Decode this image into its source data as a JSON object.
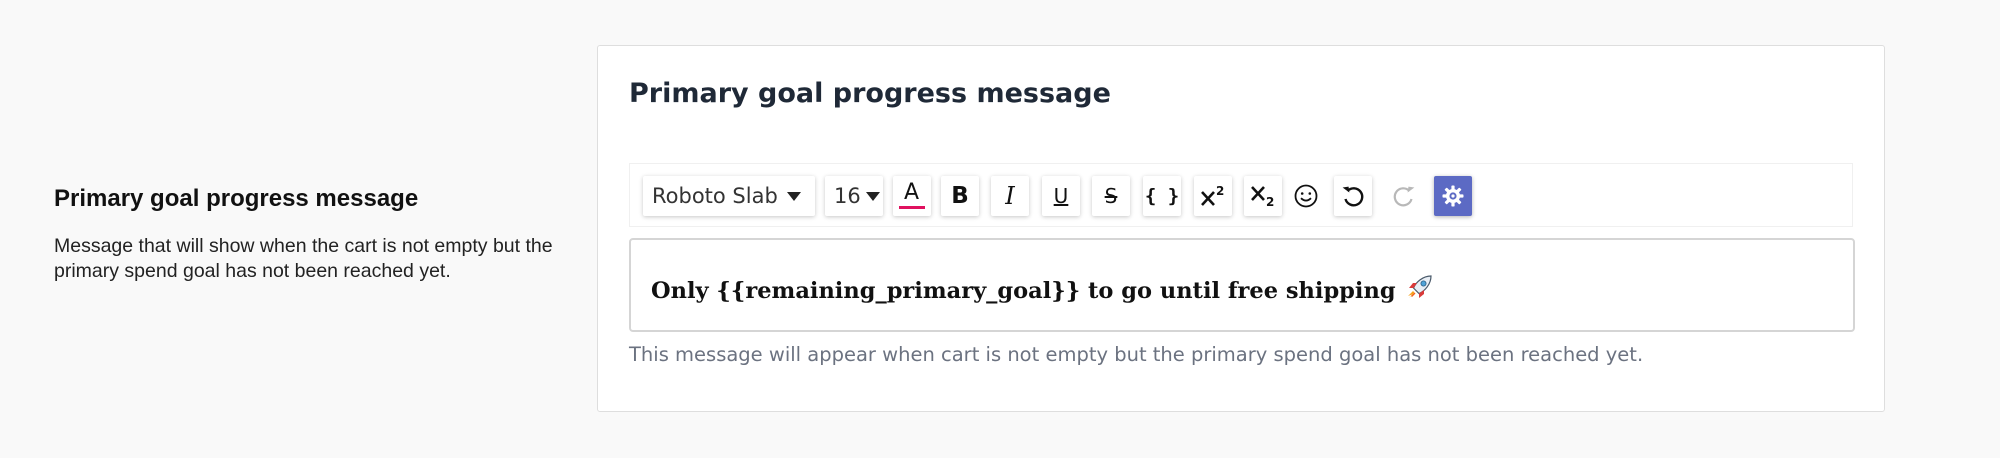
{
  "settings_section": {
    "title": "Primary goal progress message",
    "description": "Message that will show when the cart is not empty but the primary spend goal has not been reached yet."
  },
  "card": {
    "title": "Primary goal progress message",
    "help_text": "This message will appear when cart is not empty but the primary spend goal has not been reached yet."
  },
  "toolbar": {
    "font_family": "Roboto Slab",
    "font_size": "16",
    "text_color": "#e0115f",
    "accent": "#5c6ac4",
    "buttons": [
      "text-color-icon",
      "bold-icon",
      "italic-icon",
      "underline-icon",
      "strikethrough-icon",
      "code-braces-icon",
      "superscript-icon",
      "subscript-icon",
      "emoji-icon",
      "undo-icon",
      "redo-icon",
      "settings-icon"
    ],
    "glyphs": {
      "text_color": "A",
      "bold": "B",
      "italic": "I",
      "underline": "U",
      "strike": "S",
      "code": "{ }"
    }
  },
  "editor": {
    "content": "Only {{remaining_primary_goal}} to go until free shipping",
    "emoji": "rocket-icon"
  }
}
